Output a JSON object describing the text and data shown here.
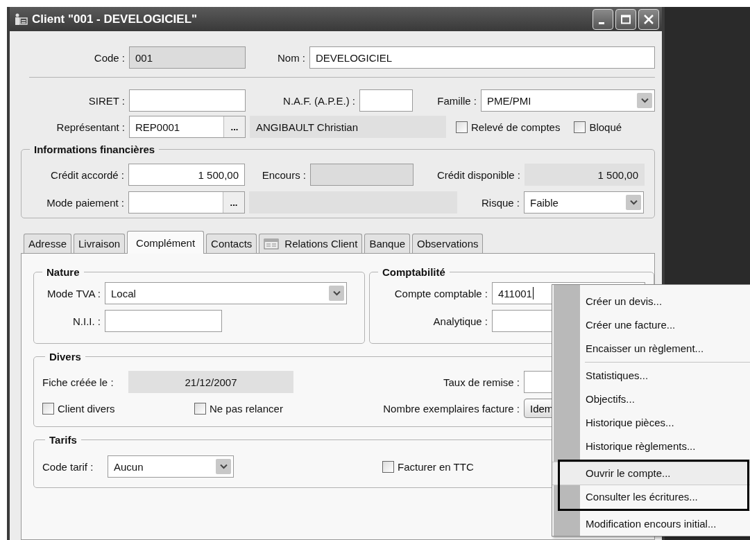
{
  "window": {
    "title": "Client \"001 - DEVELOGICIEL\""
  },
  "header": {
    "code": {
      "label": "Code :",
      "value": "001"
    },
    "nom": {
      "label": "Nom :",
      "value": "DEVELOGICIEL"
    }
  },
  "identity": {
    "siret": {
      "label": "SIRET :"
    },
    "naf": {
      "label": "N.A.F. (A.P.E.) :"
    },
    "famille": {
      "label": "Famille :",
      "value": "PME/PMI"
    },
    "representant": {
      "label": "Représentant :",
      "value": "REP0001",
      "button": "...",
      "name": "ANGIBAULT Christian"
    },
    "checkboxes": [
      {
        "label": "Relevé de comptes",
        "checked": false
      },
      {
        "label": "Bloqué",
        "checked": false
      }
    ]
  },
  "finance": {
    "title": "Informations financières",
    "credit_accorde": {
      "label": "Crédit accordé :",
      "value": "1 500,00"
    },
    "encours": {
      "label": "Encours :"
    },
    "credit_disponible": {
      "label": "Crédit disponible :",
      "value": "1 500,00"
    },
    "mode_paiement": {
      "label": "Mode paiement :",
      "button": "..."
    },
    "risque": {
      "label": "Risque :",
      "value": "Faible"
    }
  },
  "tabs": [
    {
      "label": "Adresse",
      "selected": false,
      "kind": "plain"
    },
    {
      "label": "Livraison",
      "selected": false,
      "kind": "plain"
    },
    {
      "label": "Complément",
      "selected": true,
      "kind": "plain"
    },
    {
      "label": "Contacts",
      "selected": false,
      "kind": "plain"
    },
    {
      "label": "Relations Client",
      "selected": false,
      "kind": "icon"
    },
    {
      "label": "Banque",
      "selected": false,
      "kind": "plain"
    },
    {
      "label": "Observations",
      "selected": false,
      "kind": "plain"
    }
  ],
  "nature": {
    "title": "Nature",
    "mode_tva": {
      "label": "Mode TVA :",
      "value": "Local"
    },
    "nii": {
      "label": "N.I.I. :"
    }
  },
  "comptabilite": {
    "title": "Comptabilité",
    "compte": {
      "label": "Compte comptable :",
      "value": "411001",
      "focused": true
    },
    "analytique": {
      "label": "Analytique :"
    }
  },
  "divers": {
    "title": "Divers",
    "fiche": {
      "label": "Fiche créée le :",
      "value": "21/12/2007"
    },
    "taux": {
      "label": "Taux de remise :"
    },
    "exemplaires": {
      "label": "Nombre exemplaires facture :",
      "value": "Idem"
    },
    "checkboxes": [
      {
        "label": "Client divers",
        "checked": false
      },
      {
        "label": "Ne pas relancer",
        "checked": false
      }
    ]
  },
  "tarifs": {
    "title": "Tarifs",
    "code_tarif": {
      "label": "Code tarif :",
      "value": "Aucun"
    },
    "ttc": {
      "label": "Facturer en TTC",
      "checked": false
    }
  },
  "context_menu": {
    "groups": [
      {
        "boxed": false,
        "items": [
          {
            "label": "Créer un devis...",
            "selected": false
          },
          {
            "label": "Créer une facture...",
            "selected": false
          },
          {
            "label": "Encaisser un règlement...",
            "selected": false
          }
        ]
      },
      {
        "boxed": false,
        "items": [
          {
            "label": "Statistiques...",
            "selected": false
          },
          {
            "label": "Objectifs...",
            "selected": false
          },
          {
            "label": "Historique pièces...",
            "selected": false
          },
          {
            "label": "Historique règlements...",
            "selected": false
          }
        ]
      },
      {
        "boxed": true,
        "items": [
          {
            "label": "Ouvrir le compte...",
            "selected": true
          },
          {
            "label": "Consulter les écritures...",
            "selected": false
          }
        ]
      },
      {
        "boxed": false,
        "items": [
          {
            "label": "Modification encours initial...",
            "selected": false
          }
        ]
      }
    ]
  }
}
